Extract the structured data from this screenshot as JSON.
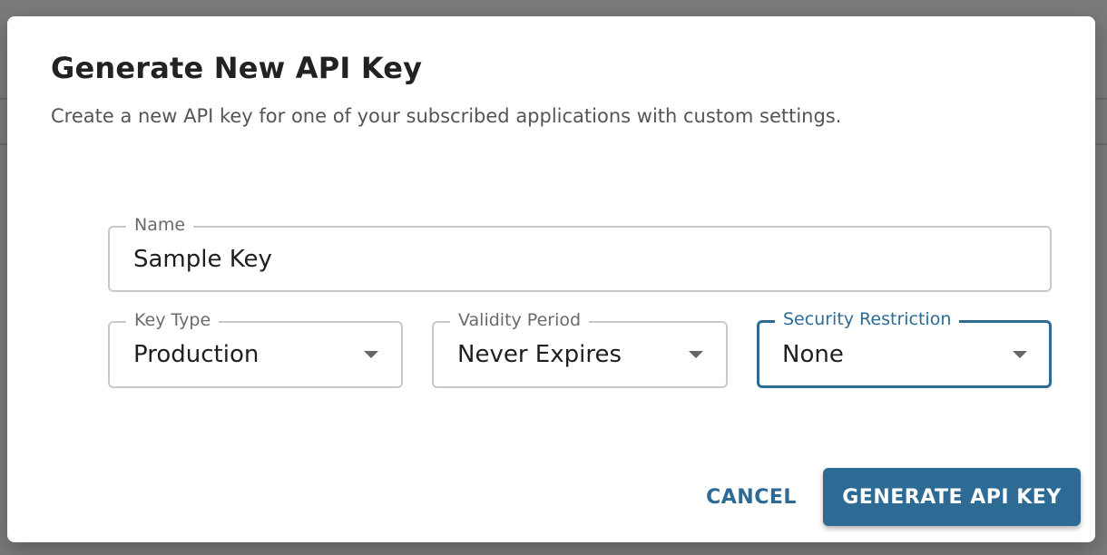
{
  "dialog": {
    "title": "Generate New API Key",
    "subtitle": "Create a new API key for one of your subscribed applications with custom settings."
  },
  "fields": {
    "name": {
      "label": "Name",
      "value": "Sample Key"
    },
    "key_type": {
      "label": "Key Type",
      "value": "Production"
    },
    "validity_period": {
      "label": "Validity Period",
      "value": "Never Expires"
    },
    "security_restriction": {
      "label": "Security Restriction",
      "value": "None",
      "focused": true
    }
  },
  "actions": {
    "cancel_label": "CANCEL",
    "generate_label": "GENERATE API KEY"
  },
  "colors": {
    "accent": "#2d6a94",
    "overlay": "#7a7a7a",
    "border": "#c9c9c9"
  },
  "icons": {
    "select_caret": "caret-down-icon"
  }
}
